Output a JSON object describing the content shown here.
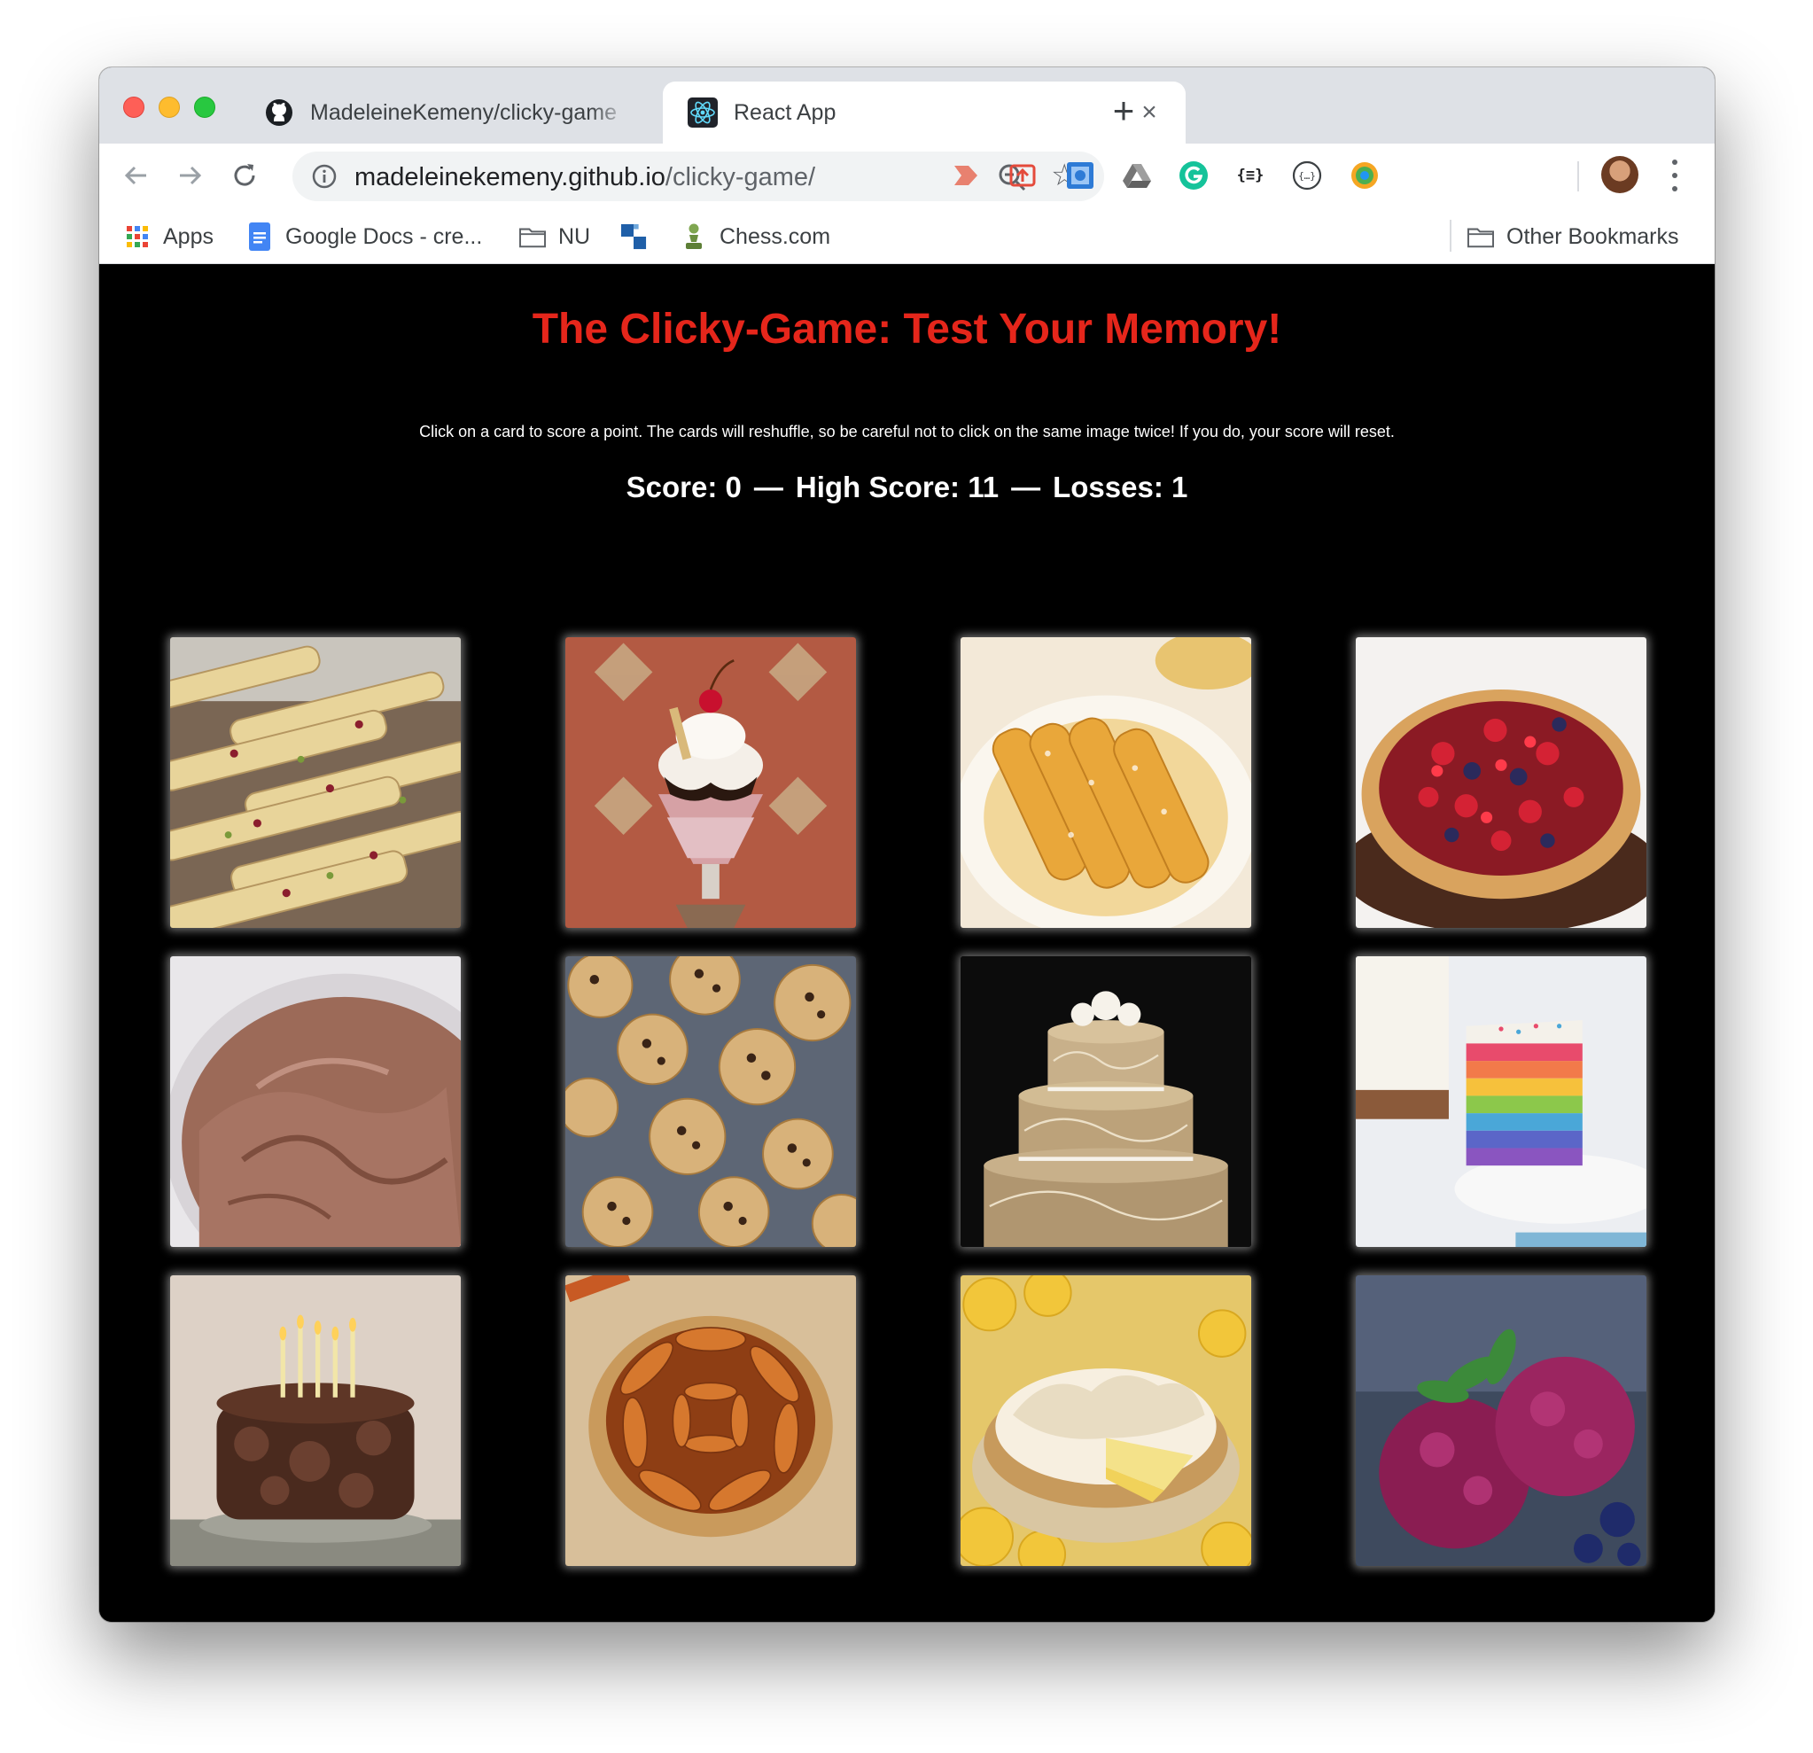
{
  "browser": {
    "tabs": [
      {
        "title": "MadeleineKemeny/clicky-game",
        "icon": "github-icon",
        "active": false
      },
      {
        "title": "React App",
        "icon": "react-icon",
        "active": true
      }
    ],
    "url": {
      "host": "madeleinekemeny.github.io",
      "path": "/clicky-game/"
    },
    "bookmarks": [
      {
        "label": "Apps",
        "icon": "apps-grid-icon"
      },
      {
        "label": "Google Docs - cre...",
        "icon": "google-docs-icon"
      },
      {
        "label": "NU",
        "icon": "folder-icon"
      },
      {
        "label": "",
        "icon": "blue-squares-icon"
      },
      {
        "label": "Chess.com",
        "icon": "chess-pawn-icon"
      }
    ],
    "other_bookmarks": "Other Bookmarks"
  },
  "game": {
    "title": "The Clicky-Game: Test Your Memory!",
    "instructions": "Click on a card to score a point. The cards will reshuffle, so be careful not to click on the same image twice! If you do, your score will reset.",
    "score_label": "Score: 0",
    "high_score_label": "High Score: 11",
    "losses_label": "Losses: 1",
    "separator": "—",
    "title_color": "#e5261b"
  },
  "cards": [
    {
      "name": "biscotti"
    },
    {
      "name": "ice-cream-sundae"
    },
    {
      "name": "crepes"
    },
    {
      "name": "berry-tart"
    },
    {
      "name": "chocolate-frosting"
    },
    {
      "name": "chocolate-chip-cookies"
    },
    {
      "name": "wedding-cake"
    },
    {
      "name": "rainbow-cake"
    },
    {
      "name": "chocolate-birthday-cake"
    },
    {
      "name": "apple-tart"
    },
    {
      "name": "lemon-meringue-pie"
    },
    {
      "name": "berry-sorbet"
    }
  ]
}
